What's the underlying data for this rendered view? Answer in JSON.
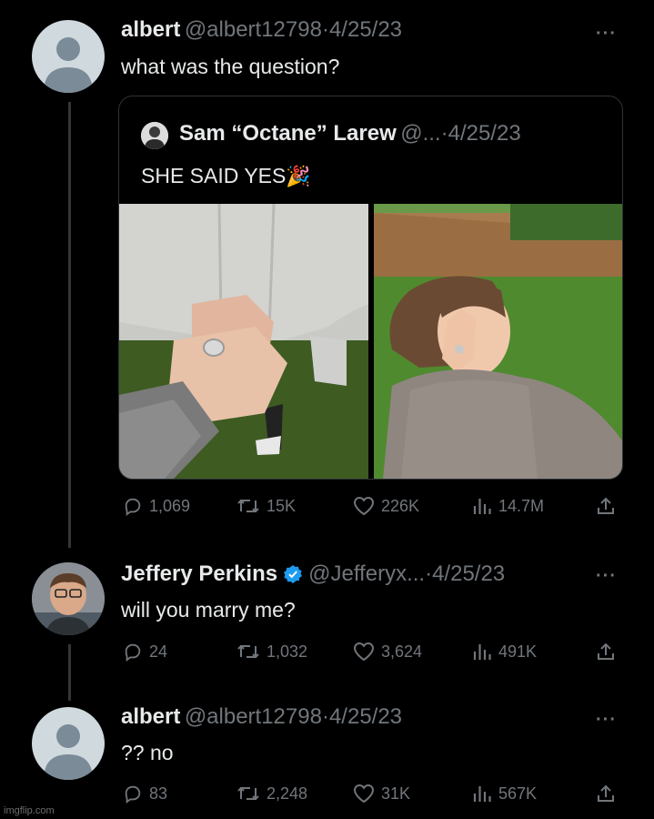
{
  "tweets": [
    {
      "name": "albert",
      "handle": "@albert12798",
      "sep": "·",
      "date": "4/25/23",
      "text": "what was the question?",
      "more": "···",
      "stats": {
        "replies": "1,069",
        "retweets": "15K",
        "likes": "226K",
        "views": "14.7M"
      }
    },
    {
      "name": "Jeffery Perkins",
      "handle": "@Jefferyx...",
      "sep": "·",
      "date": "4/25/23",
      "text": "will you marry me?",
      "more": "···",
      "stats": {
        "replies": "24",
        "retweets": "1,032",
        "likes": "3,624",
        "views": "491K"
      }
    },
    {
      "name": "albert",
      "handle": "@albert12798",
      "sep": "·",
      "date": "4/25/23",
      "text": "?? no",
      "more": "···",
      "stats": {
        "replies": "83",
        "retweets": "2,248",
        "likes": "31K",
        "views": "567K"
      }
    }
  ],
  "quote": {
    "name": "Sam “Octane” Larew",
    "handle": "@...",
    "sep": "·",
    "date": "4/25/23",
    "text": "SHE SAID YES",
    "emoji": "🎉"
  },
  "watermark": "imgflip.com",
  "colors": {
    "background": "#000000",
    "text": "#e7e9ea",
    "muted": "#71767b",
    "verified": "#1d9bf0",
    "border": "#2f3336"
  }
}
